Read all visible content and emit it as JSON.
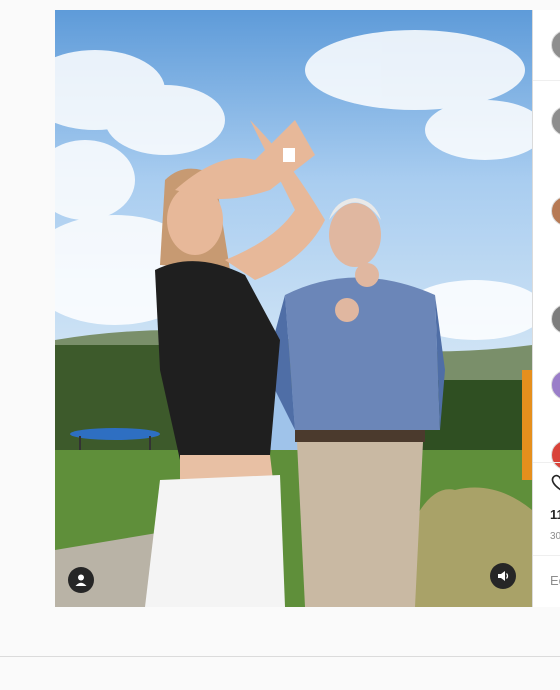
{
  "post": {
    "media": {
      "type": "video",
      "description": ""
    },
    "icons": {
      "user_tag": "user-silhouette-icon",
      "sound": "speaker-icon",
      "like": "heart-icon"
    },
    "sidebar": {
      "likes_text": "11",
      "time_text": "30",
      "comment_placeholder": "Ec"
    }
  }
}
